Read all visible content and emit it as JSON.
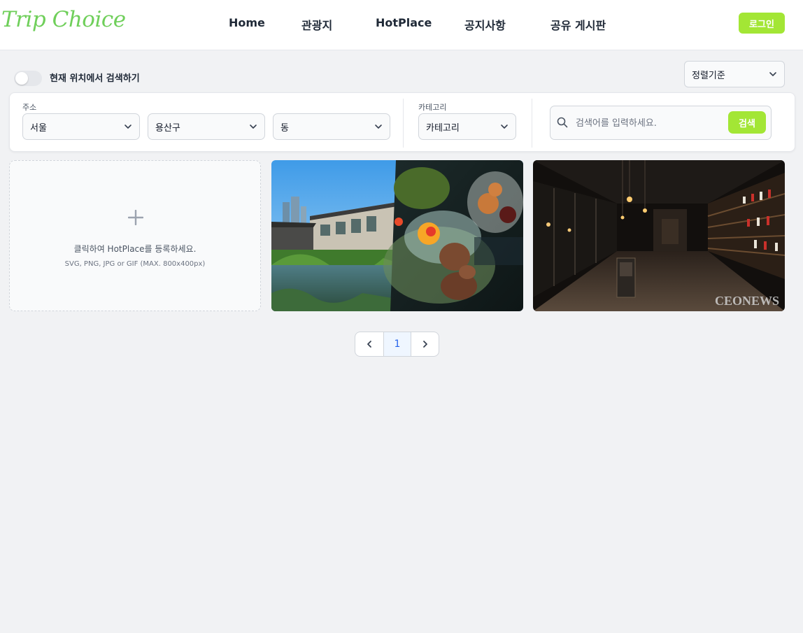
{
  "header": {
    "logo": "Trip Choice",
    "nav": [
      "Home",
      "관광지",
      "HotPlace",
      "공지사항",
      "공유 게시판"
    ],
    "login_label": "로그인"
  },
  "controls": {
    "location_toggle_label": "현재 위치에서 검색하기",
    "location_toggle_on": false,
    "sort_label": "정렬기준"
  },
  "filters": {
    "address_label": "주소",
    "city": "서울",
    "district": "용산구",
    "dong": "동",
    "category_label": "카테고리",
    "category": "카테고리",
    "search_placeholder": "검색어를 입력하세요.",
    "search_button": "검색"
  },
  "upload": {
    "title": "클릭하여 HotPlace를 등록하세요.",
    "subtitle": "SVG, PNG, JPG or GIF (MAX. 800x400px)"
  },
  "photos": [
    {
      "icon": "garden-dessert-photo"
    },
    {
      "icon": "wine-shop-photo",
      "watermark": "CEONEWS"
    }
  ],
  "pagination": {
    "current_page": "1"
  },
  "colors": {
    "accent": "#a3e635",
    "logo": "#6fcf5a",
    "page_active": "#2563eb"
  }
}
